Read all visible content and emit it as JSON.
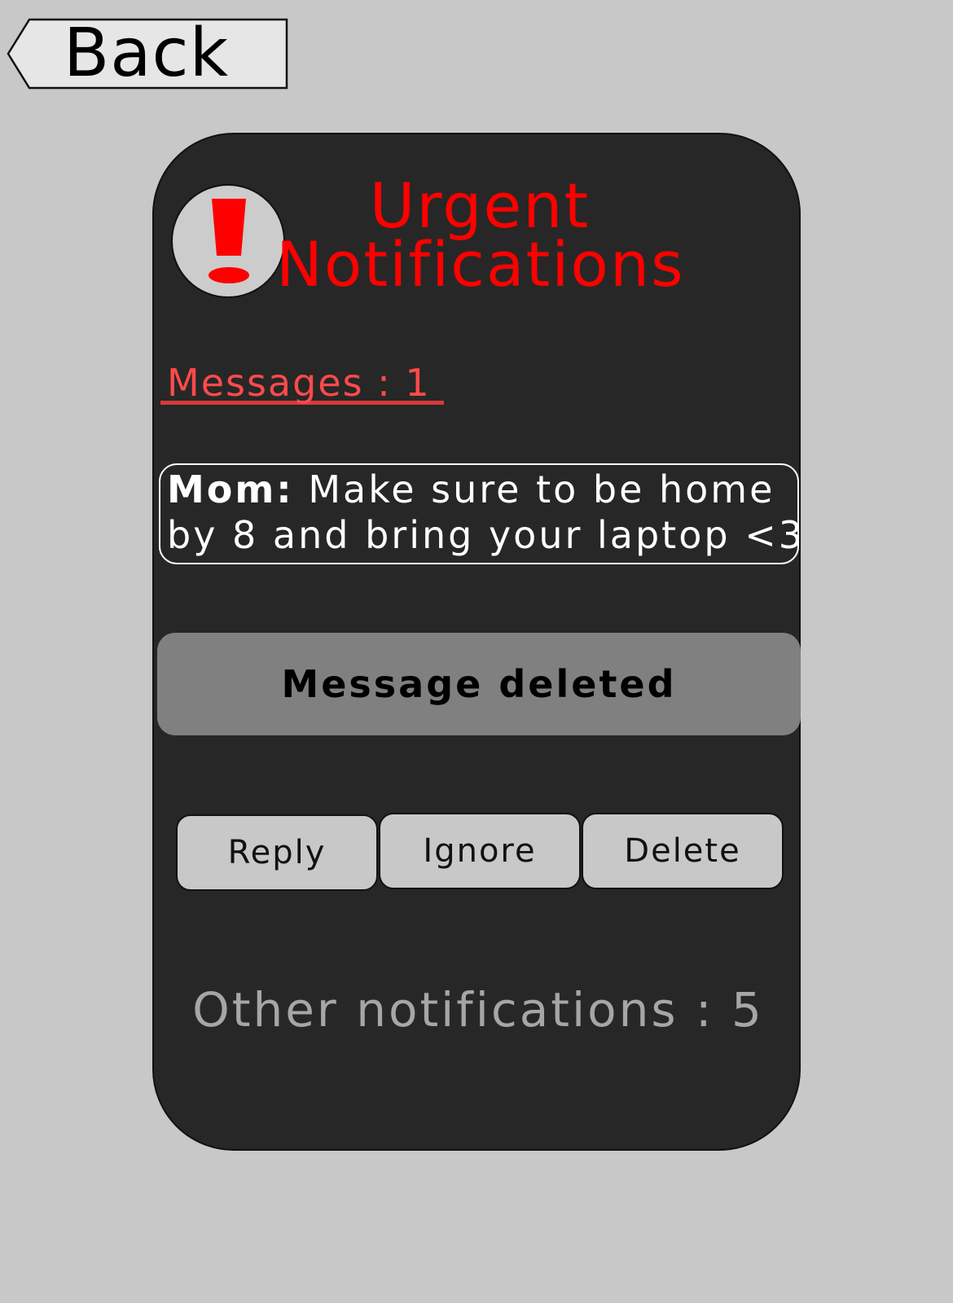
{
  "back_button": {
    "label": "Back"
  },
  "header": {
    "icon": "exclamation-icon",
    "title_line1": "Urgent",
    "title_line2": "Notifications"
  },
  "messages": {
    "count_label": "Messages : 1",
    "items": [
      {
        "sender": "Mom:",
        "text_line1": " Make sure to be home",
        "text_line2": "by 8 and bring your laptop <3"
      }
    ]
  },
  "status": {
    "deleted_text": "Message deleted"
  },
  "actions": {
    "reply_label": "Reply",
    "ignore_label": "Ignore",
    "delete_label": "Delete"
  },
  "footer": {
    "other_notifications": "Other notifications : 5"
  },
  "colors": {
    "background": "#c8c8c8",
    "panel": "#272727",
    "urgent_red": "#ff0000",
    "messages_red": "#ff4a4a",
    "banner_gray": "#808080",
    "button_gray": "#c8c8c8",
    "muted_text": "#a6a6a6"
  }
}
